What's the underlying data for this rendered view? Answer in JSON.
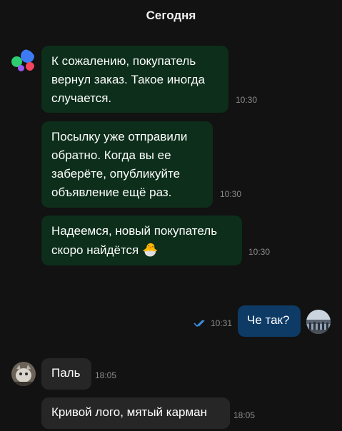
{
  "date_header": "Сегодня",
  "messages": [
    {
      "text": "К сожалению, покупатель\nвернул заказ. Такое иногда\nслучается.",
      "time": "10:30"
    },
    {
      "text": "Посылку уже отправили\nобратно. Когда вы ее\nзаберёте, опубликуйте\nобъявление ещё раз.",
      "time": "10:30"
    },
    {
      "text": "Надеемся, новый покупатель\nскоро найдётся",
      "emoji": "🐣",
      "time": "10:30"
    },
    {
      "text": "Че так?",
      "time": "10:31",
      "status": "read"
    },
    {
      "text": "Паль",
      "time": "18:05"
    },
    {
      "text": "Кривой лого, мятый карман",
      "time": "18:05"
    }
  ],
  "colors": {
    "background": "#121212",
    "incoming_bubble": "#0c2e1a",
    "outgoing_bubble": "#0d3b66",
    "user_bubble": "#262626",
    "read_ticks": "#3d8fe0",
    "logo_blue": "#3d7bf5",
    "logo_green": "#2ecc71",
    "logo_purple": "#9b59f5",
    "logo_red": "#f5455c"
  },
  "icons": {
    "brand_avatar": "service-logo-icon",
    "read_status": "double-check-icon"
  }
}
